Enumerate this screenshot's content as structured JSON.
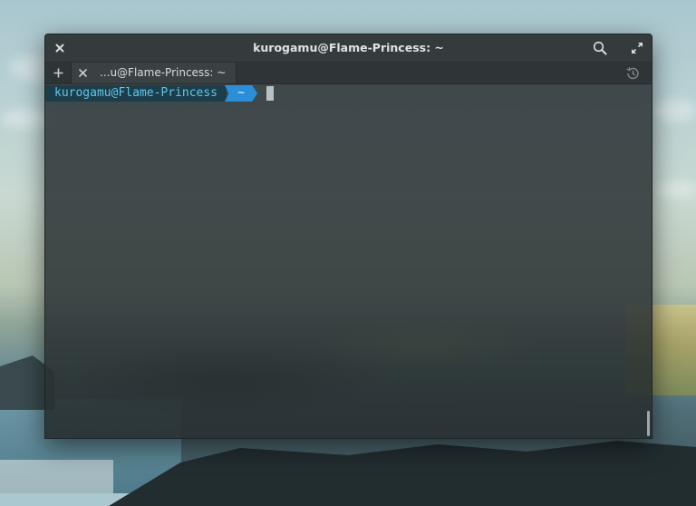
{
  "window": {
    "title": "kurogamu@Flame-Princess: ~"
  },
  "tabs": [
    {
      "label": "...u@Flame-Princess: ~"
    }
  ],
  "terminal": {
    "prompt_user": "kurogamu@Flame-Princess",
    "prompt_dir": "~"
  },
  "icons": {
    "close": "close-icon",
    "search": "search-icon",
    "maximize": "maximize-icon",
    "new_tab": "plus-icon",
    "tab_close": "close-icon",
    "history": "history-icon"
  },
  "colors": {
    "prompt_user_bg": "#1e3d4b",
    "prompt_user_fg": "#5fc7e8",
    "prompt_dir_bg": "#2a8fd8",
    "terminal_bg": "#2b3234"
  }
}
